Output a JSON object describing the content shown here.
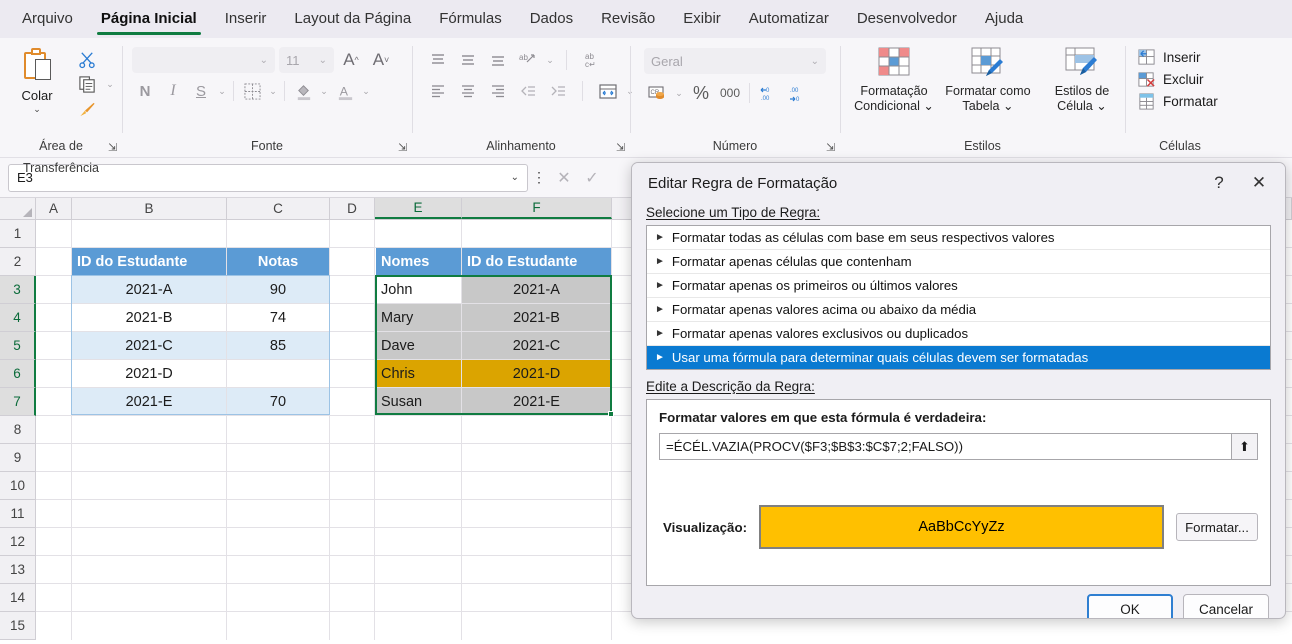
{
  "ribbon": {
    "tabs": [
      {
        "label": "Arquivo",
        "active": false
      },
      {
        "label": "Página Inicial",
        "active": true
      },
      {
        "label": "Inserir",
        "active": false
      },
      {
        "label": "Layout da Página",
        "active": false
      },
      {
        "label": "Fórmulas",
        "active": false
      },
      {
        "label": "Dados",
        "active": false
      },
      {
        "label": "Revisão",
        "active": false
      },
      {
        "label": "Exibir",
        "active": false
      },
      {
        "label": "Automatizar",
        "active": false
      },
      {
        "label": "Desenvolvedor",
        "active": false
      },
      {
        "label": "Ajuda",
        "active": false
      }
    ],
    "clipboard": {
      "group_label": "Área de Transferência",
      "paste_label": "Colar"
    },
    "font": {
      "group_label": "Fonte",
      "font_name_value": "",
      "font_size_value": "11",
      "bold": "N",
      "italic": "I",
      "underline": "S"
    },
    "alignment": {
      "group_label": "Alinhamento"
    },
    "number": {
      "group_label": "Número",
      "format_value": "Geral",
      "percent": "%",
      "thousands": "000"
    },
    "styles": {
      "group_label": "Estilos",
      "conditional": "Formatação\nCondicional",
      "conditional_l1": "Formatação",
      "conditional_l2": "Condicional ⌄",
      "table_l1": "Formatar como",
      "table_l2": "Tabela ⌄",
      "cellstyles_l1": "Estilos de",
      "cellstyles_l2": "Célula ⌄"
    },
    "cells": {
      "group_label": "Células",
      "insert": "Inserir",
      "delete": "Excluir",
      "format": "Formatar"
    }
  },
  "formula_bar": {
    "name_box_value": "E3",
    "cancel_icon": "✕",
    "confirm_icon": "✓"
  },
  "grid": {
    "columns": [
      "A",
      "B",
      "C",
      "D",
      "E",
      "F"
    ],
    "selected_columns": [
      "E",
      "F"
    ],
    "rows": [
      "1",
      "2",
      "3",
      "4",
      "5",
      "6",
      "7",
      "8",
      "9",
      "10",
      "11",
      "12",
      "13",
      "14",
      "15"
    ],
    "selected_rows": [
      "3",
      "4",
      "5",
      "6",
      "7"
    ],
    "table_left": {
      "headers": [
        "ID do Estudante",
        "Notas"
      ],
      "rows": [
        {
          "id": "2021-A",
          "nota": "90"
        },
        {
          "id": "2021-B",
          "nota": "74"
        },
        {
          "id": "2021-C",
          "nota": "85"
        },
        {
          "id": "2021-D",
          "nota": ""
        },
        {
          "id": "2021-E",
          "nota": "70"
        }
      ]
    },
    "table_right": {
      "headers": [
        "Nomes",
        "ID do Estudante"
      ],
      "rows": [
        {
          "nome": "John",
          "id": "2021-A",
          "highlight": false,
          "active": true
        },
        {
          "nome": "Mary",
          "id": "2021-B",
          "highlight": false,
          "active": false
        },
        {
          "nome": "Dave",
          "id": "2021-C",
          "highlight": false,
          "active": false
        },
        {
          "nome": "Chris",
          "id": "2021-D",
          "highlight": true,
          "active": false
        },
        {
          "nome": "Susan",
          "id": "2021-E",
          "highlight": false,
          "active": false
        }
      ]
    }
  },
  "dialog": {
    "title": "Editar Regra de Formatação",
    "help_icon": "?",
    "close_icon": "✕",
    "rule_type_label": "Selecione um Tipo de Regra:",
    "rule_types": [
      {
        "label": "Formatar todas as células com base em seus respectivos valores",
        "selected": false
      },
      {
        "label": "Formatar apenas células que contenham",
        "selected": false
      },
      {
        "label": "Formatar apenas os primeiros ou últimos valores",
        "selected": false
      },
      {
        "label": "Formatar apenas valores acima ou abaixo da média",
        "selected": false
      },
      {
        "label": "Formatar apenas valores exclusivos ou duplicados",
        "selected": false
      },
      {
        "label": "Usar uma fórmula para determinar quais células devem ser formatadas",
        "selected": true
      }
    ],
    "rule_desc_label": "Edite a Descrição da Regra:",
    "formula_title": "Formatar valores em que esta fórmula é verdadeira:",
    "formula_value": "=ÉCÉL.VAZIA(PROCV($F3;$B$3:$C$7;2;FALSO))",
    "collapse_icon": "⬆",
    "preview_label": "Visualização:",
    "preview_text": "AaBbCcYyZz",
    "preview_fill": "#ffc000",
    "format_button": "Formatar...",
    "ok_button": "OK",
    "cancel_button": "Cancelar"
  },
  "colors": {
    "accent_green": "#107c41",
    "header_blue": "#5b9bd5",
    "band_blue": "#ddebf7",
    "highlight_orange": "#dba400",
    "select_blue": "#0a7ad1"
  }
}
